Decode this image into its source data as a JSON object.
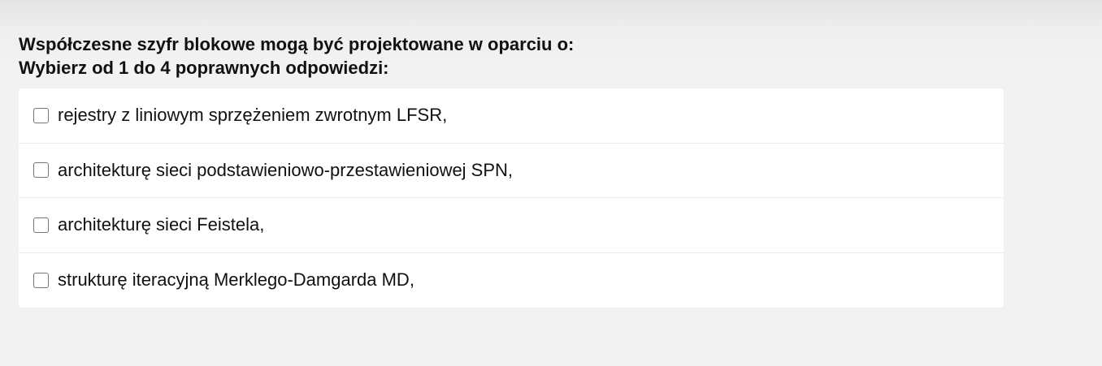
{
  "question": {
    "title": "Współczesne szyfr blokowe mogą być projektowane w oparciu o:",
    "instruction": "Wybierz od 1 do 4 poprawnych odpowiedzi:"
  },
  "answers": [
    {
      "label": "rejestry z liniowym sprzężeniem zwrotnym LFSR,",
      "checked": false
    },
    {
      "label": "architekturę sieci podstawieniowo-przestawieniowej SPN,",
      "checked": false
    },
    {
      "label": "architekturę sieci Feistela,",
      "checked": false
    },
    {
      "label": "strukturę iteracyjną Merklego-Damgarda MD,",
      "checked": false
    }
  ]
}
